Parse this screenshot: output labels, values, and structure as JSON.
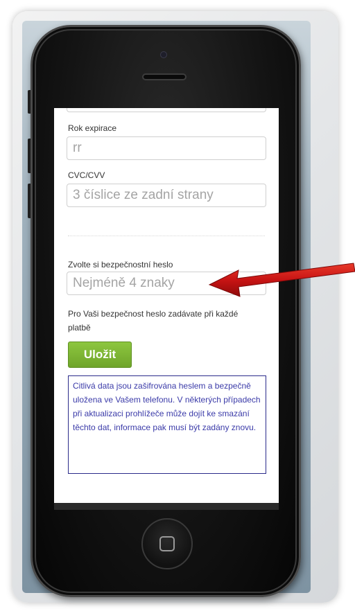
{
  "form": {
    "expiry_year_label": "Rok expirace",
    "expiry_year_placeholder": "rr",
    "cvc_label": "CVC/CVV",
    "cvc_placeholder": "3 číslice ze zadní strany",
    "password_label": "Zvolte si bezpečnostní heslo",
    "password_placeholder": "Nejméně 4 znaky",
    "password_hint": "Pro Vaši bezpečnost heslo zadávate při každé platbě",
    "save_label": "Uložit",
    "info_text": "Citlivá data jsou zašifrována heslem a bezpečně uložena ve Vašem telefonu. V některých případech při aktualizaci prohlížeče může dojít ke smazání těchto dat, informace pak musí být zadány znovu."
  },
  "colors": {
    "save_button": "#7ab534",
    "info_text": "#3a3aa8",
    "info_border": "#2a2a8a",
    "arrow": "#c81414"
  },
  "icons": {
    "home": "home-square-icon",
    "arrow": "red-arrow-icon"
  }
}
